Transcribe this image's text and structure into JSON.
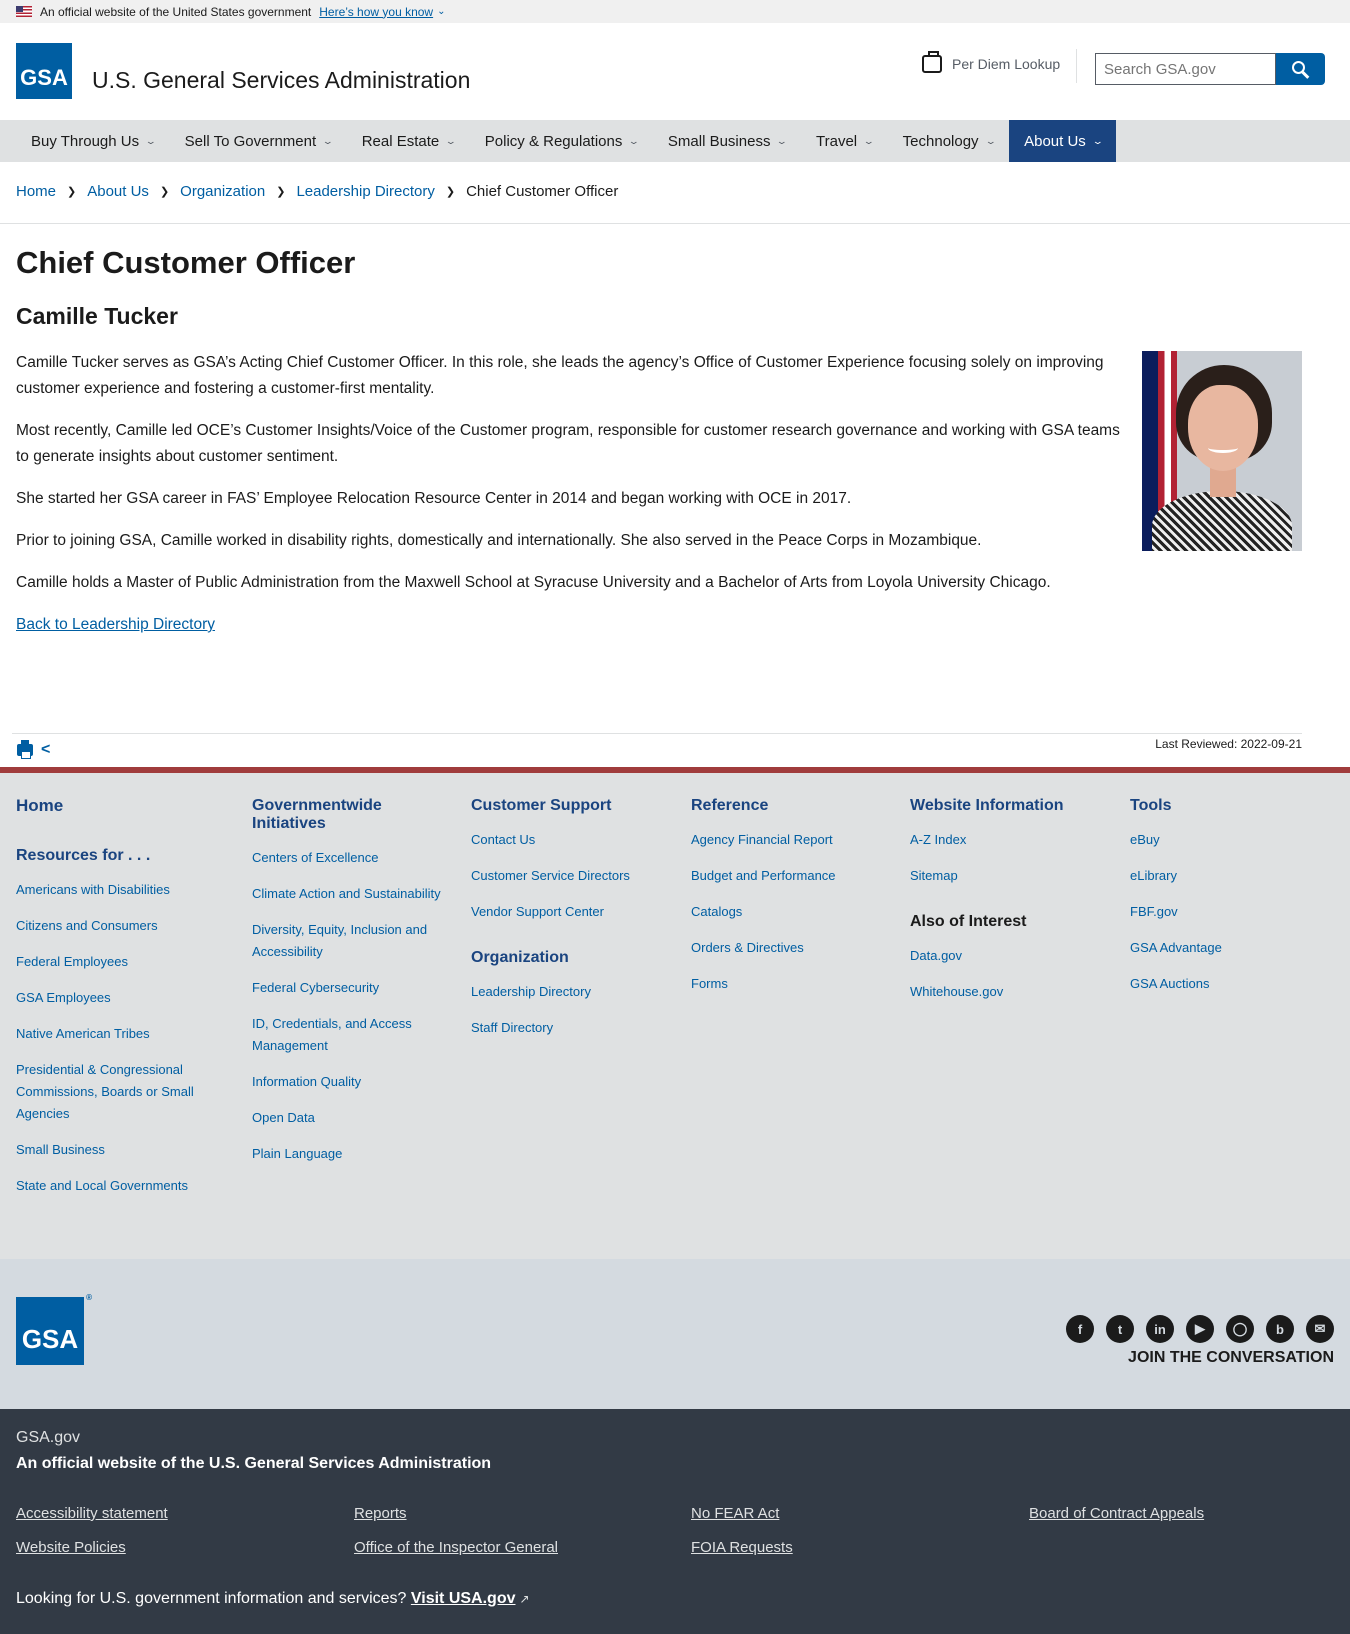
{
  "banner": {
    "official_text": "An official website of the United States government",
    "how_link": "Here’s how you know"
  },
  "header": {
    "logo_text": "GSA",
    "site_title": "U.S. General Services Administration",
    "per_diem": "Per Diem Lookup",
    "search_placeholder": "Search GSA.gov"
  },
  "nav": {
    "items": [
      {
        "label": "Buy Through Us"
      },
      {
        "label": "Sell To Government"
      },
      {
        "label": "Real Estate"
      },
      {
        "label": "Policy & Regulations"
      },
      {
        "label": "Small Business"
      },
      {
        "label": "Travel"
      },
      {
        "label": "Technology"
      },
      {
        "label": "About Us"
      }
    ],
    "active": "About Us"
  },
  "breadcrumb": {
    "items": [
      "Home",
      "About Us",
      "Organization",
      "Leadership Directory"
    ],
    "current": "Chief Customer Officer"
  },
  "main": {
    "title": "Chief Customer Officer",
    "name": "Camille Tucker",
    "paragraphs": [
      "Camille Tucker serves as GSA’s Acting Chief Customer Officer. In this role, she leads the agency’s Office of Customer Experience focusing solely on improving customer experience and fostering a customer-first mentality.",
      "Most recently, Camille led OCE’s Customer Insights/Voice of the Customer program, responsible for customer research governance and working with GSA teams to generate insights about customer sentiment.",
      "She started her GSA career in FAS’ Employee Relocation Resource Center in 2014 and began working with OCE in 2017.",
      "Prior to joining GSA, Camille worked in disability rights, domestically and internationally. She also served in the Peace Corps in Mozambique.",
      "Camille holds a Master of Public Administration from the Maxwell School at Syracuse University and a Bachelor of Arts from Loyola University Chicago."
    ],
    "back_link": "Back to Leadership Directory",
    "last_reviewed": "Last Reviewed: 2022-09-21"
  },
  "footer": {
    "col1": {
      "home": "Home",
      "resources_title": "Resources for . . .",
      "links": [
        "Americans with Disabilities",
        "Citizens and Consumers",
        "Federal Employees",
        "GSA Employees",
        "Native American Tribes",
        "Presidential & Congressional Commissions, Boards or Small Agencies",
        "Small Business",
        "State and Local Governments"
      ]
    },
    "col2": {
      "title": "Governmentwide Initiatives",
      "links": [
        "Centers of Excellence",
        "Climate Action and Sustainability",
        "Diversity, Equity, Inclusion and Accessibility",
        "Federal Cybersecurity",
        "ID, Credentials, and Access Management",
        "Information Quality",
        "Open Data",
        "Plain Language"
      ]
    },
    "col3": {
      "title": "Customer Support",
      "links": [
        "Contact Us",
        "Customer Service Directors",
        "Vendor Support Center"
      ],
      "title2": "Organization",
      "links2": [
        "Leadership Directory",
        "Staff Directory"
      ]
    },
    "col4": {
      "title": "Reference",
      "links": [
        "Agency Financial Report",
        "Budget and Performance",
        "Catalogs",
        "Orders & Directives",
        "Forms"
      ]
    },
    "col5": {
      "title": "Website Information",
      "links": [
        "A-Z Index",
        "Sitemap"
      ],
      "title2": "Also of Interest",
      "links2": [
        "Data.gov",
        "Whitehouse.gov"
      ]
    },
    "col6": {
      "title": "Tools",
      "links": [
        "eBuy",
        "eLibrary",
        "FBF.gov",
        "GSA Advantage",
        "GSA Auctions"
      ]
    },
    "logo_text": "GSA",
    "socials": [
      "facebook-icon",
      "twitter-icon",
      "linkedin-icon",
      "youtube-icon",
      "instagram-icon",
      "blog-icon",
      "email-icon"
    ],
    "join": "JOIN THE CONVERSATION",
    "site": "GSA.gov",
    "official": "An official website of the U.S. General Services Administration",
    "links": {
      "accessibility": "Accessibility statement",
      "reports": "Reports",
      "nofear": "No FEAR Act",
      "board": "Board of Contract Appeals",
      "policies": "Website Policies",
      "oig": "Office of the Inspector General",
      "foia": "FOIA Requests"
    },
    "looking": "Looking for U.S. government information and services?",
    "visit": "Visit USA.gov"
  }
}
